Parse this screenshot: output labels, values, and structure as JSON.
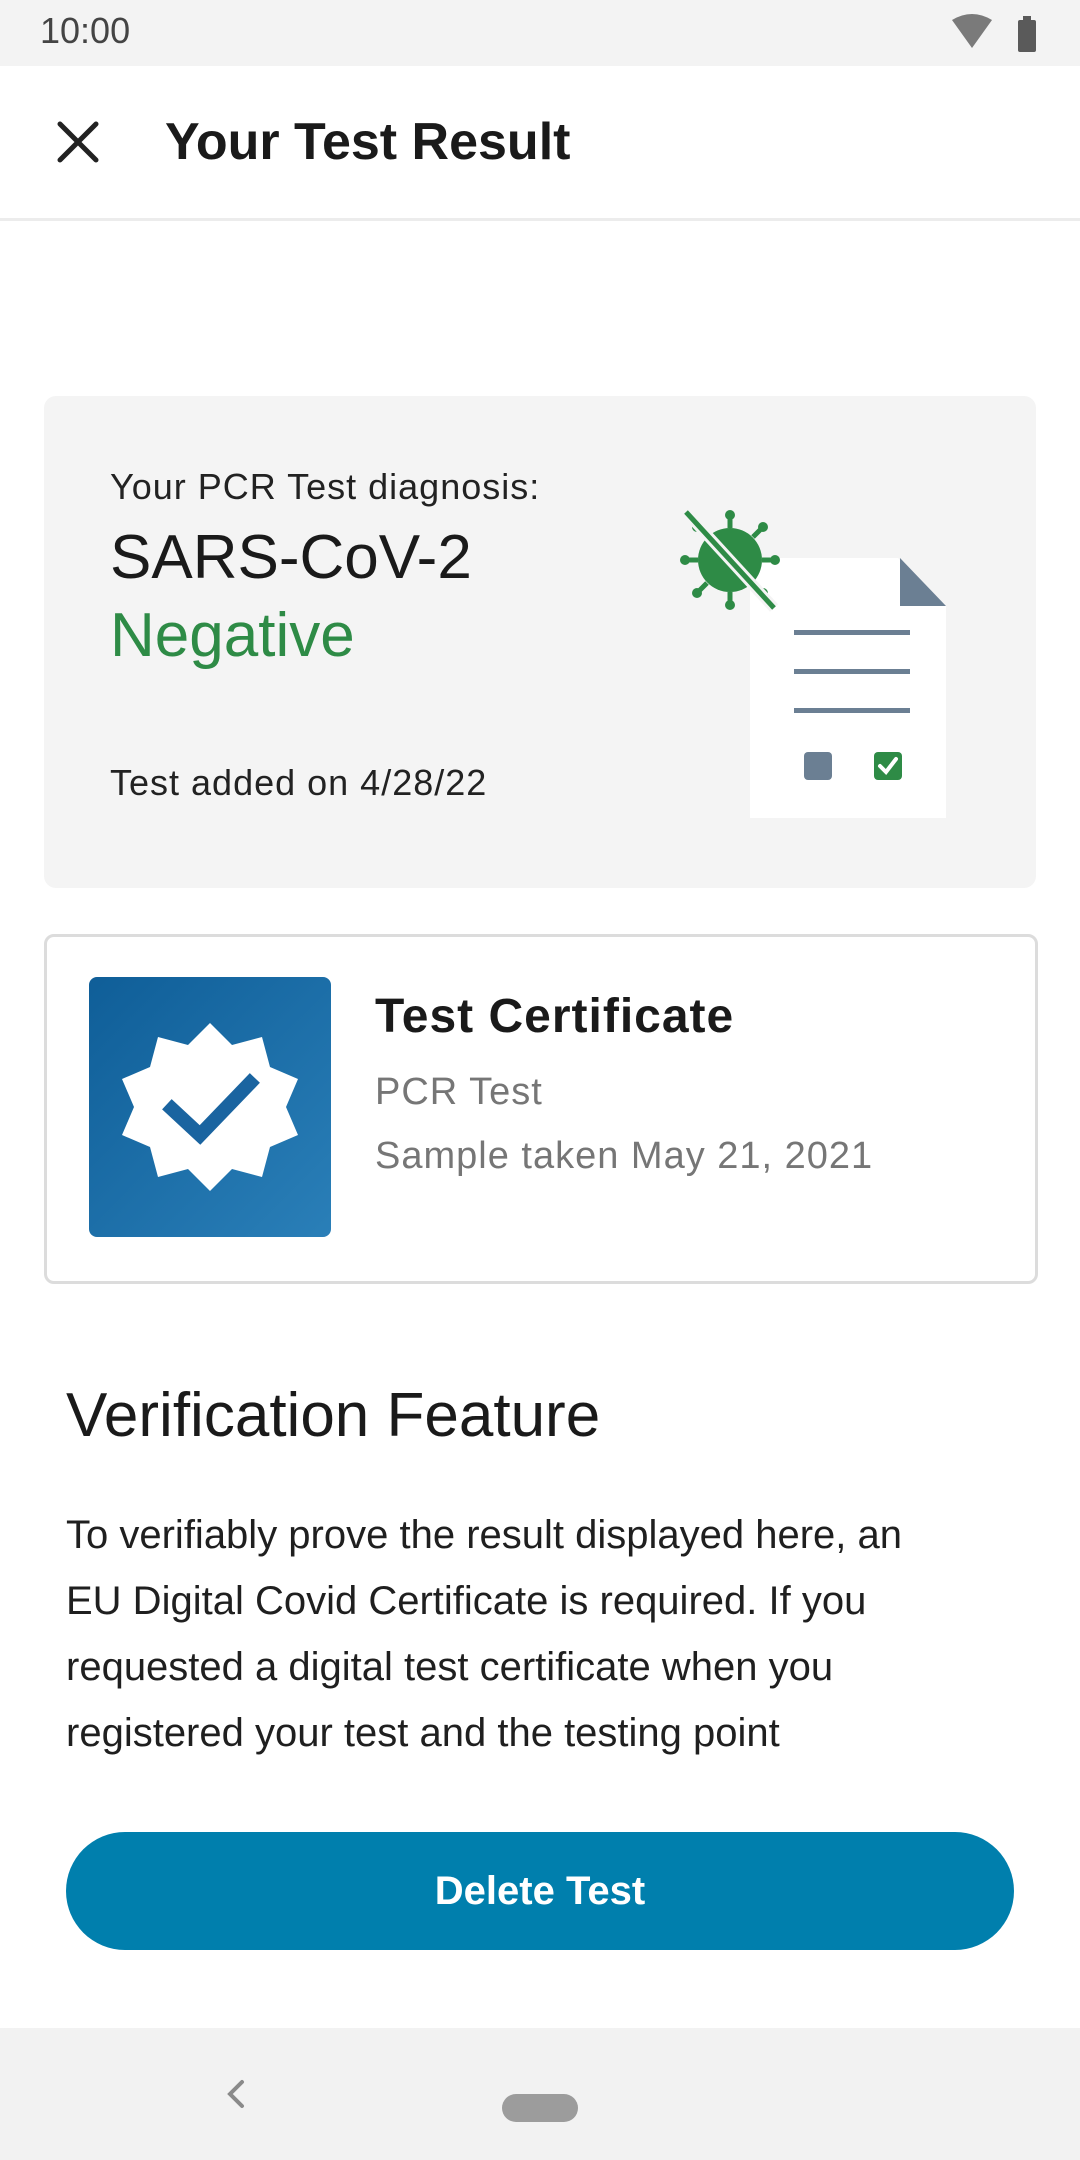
{
  "status_bar": {
    "time": "10:00"
  },
  "toolbar": {
    "title": "Your Test Result"
  },
  "result_card": {
    "diagnosis_label": "Your PCR Test diagnosis:",
    "virus": "SARS-CoV-2",
    "result": "Negative",
    "added_date": "Test added on 4/28/22"
  },
  "certificate": {
    "title": "Test Certificate",
    "type": "PCR Test",
    "sample": "Sample taken May 21, 2021"
  },
  "verification": {
    "heading": "Verification Feature",
    "body": "To verifiably prove the result displayed here, an EU Digital Covid Certificate is required. If you requested a digital test certificate when you registered your test and the testing point"
  },
  "actions": {
    "delete_label": "Delete Test"
  },
  "colors": {
    "accent": "#007fad",
    "negative_green": "#2e8b46",
    "certificate_blue": "#1568a8",
    "illustration_gray": "#6b7f93"
  }
}
